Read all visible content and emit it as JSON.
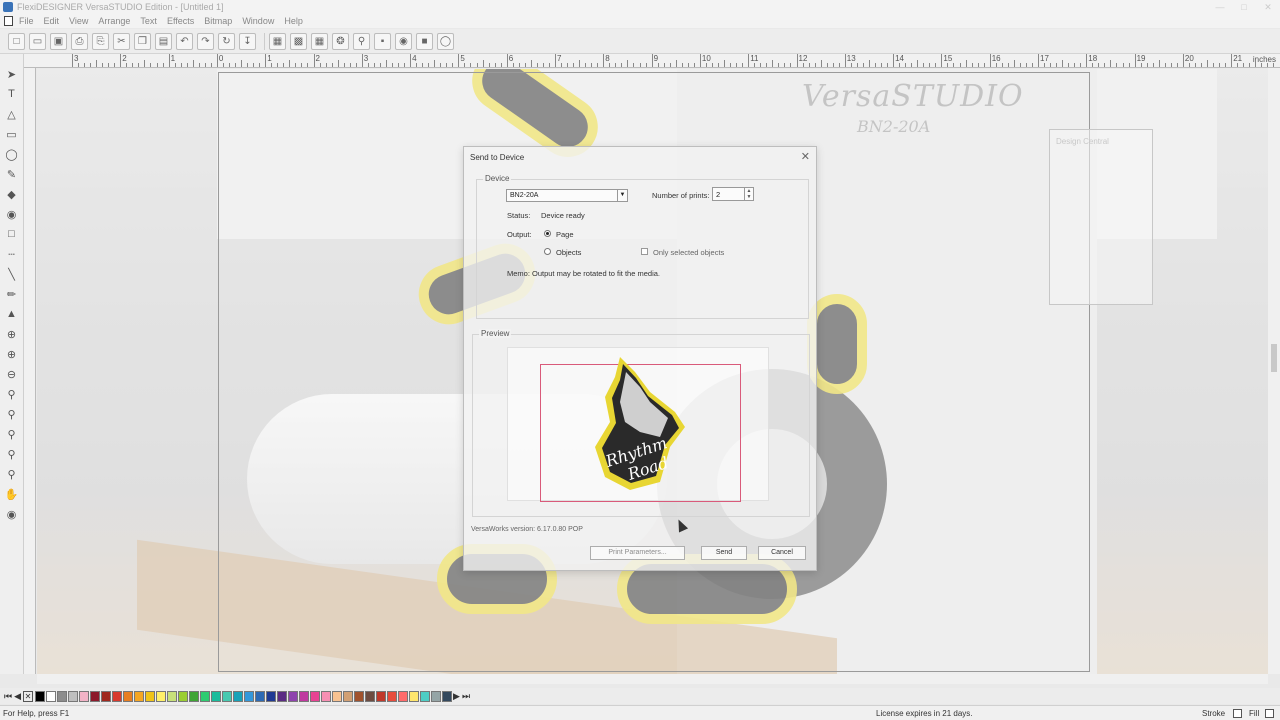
{
  "window": {
    "title": "FlexiDESIGNER VersaSTUDIO Edition - [Untitled 1]"
  },
  "menu": [
    "File",
    "Edit",
    "View",
    "Arrange",
    "Text",
    "Effects",
    "Bitmap",
    "Window",
    "Help"
  ],
  "ruler": {
    "labels": [
      "3",
      "2",
      "1",
      "0",
      "1",
      "2",
      "3",
      "4",
      "5",
      "6",
      "7",
      "8",
      "9",
      "10",
      "11",
      "12",
      "13",
      "14",
      "15",
      "16",
      "17",
      "18",
      "19",
      "20",
      "21"
    ],
    "unit": "inches"
  },
  "canvas": {
    "brand": "VersaSTUDIO",
    "model": "BN2-20A"
  },
  "ghost_panel": {
    "title": "Design Central"
  },
  "dialog": {
    "title": "Send to Device",
    "device_group": "Device",
    "device_value": "BN2-20A",
    "number_of_prints_label": "Number of prints:",
    "number_of_prints_value": "2",
    "status_label": "Status:",
    "status_value": "Device ready",
    "output_label": "Output:",
    "output_page": "Page",
    "output_objects": "Objects",
    "output_selected": "Page",
    "only_selected_label": "Only selected objects",
    "only_selected_checked": false,
    "memo": "Memo: Output may be rotated to fit the media.",
    "preview_group": "Preview",
    "preview_art_text": [
      "Rhythm",
      "Road"
    ],
    "version": "VersaWorks version: 6.17.0.80 POP",
    "print_parameters_label": "Print Parameters...",
    "send_label": "Send",
    "cancel_label": "Cancel"
  },
  "statusbar": {
    "help": "For Help, press F1",
    "license": "License expires in 21 days.",
    "stroke": "Stroke",
    "fill": "Fill"
  },
  "colors": {
    "sticker_outline": "#e8d633",
    "media_outline": "#d95a7a",
    "palette": [
      "#000000",
      "#ffffff",
      "#8c8c8c",
      "#bfbfbf",
      "#f2b3c6",
      "#8c1a2b",
      "#a0281e",
      "#d83a2e",
      "#e67e22",
      "#f5a623",
      "#f0c419",
      "#fff06a",
      "#c8e07a",
      "#9acd32",
      "#3fa535",
      "#2ecc71",
      "#1abc9c",
      "#48c9b0",
      "#17a2b8",
      "#3498db",
      "#2d6ab4",
      "#1f3a93",
      "#5b2c83",
      "#8e44ad",
      "#c0399f",
      "#e84393",
      "#f78fb3",
      "#f8c291",
      "#d1a074",
      "#a0522d",
      "#6d4c41",
      "#c0392b",
      "#e74c3c",
      "#ff6b6b",
      "#ffe66d",
      "#4ecdc4",
      "#95a5a6",
      "#34495e"
    ]
  }
}
